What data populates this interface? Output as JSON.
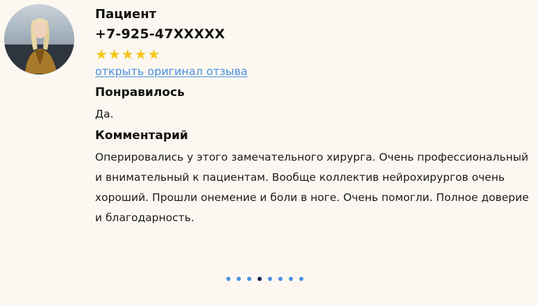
{
  "review": {
    "author": "Пациент",
    "phone": "+7-925-47XXXXX",
    "rating": 5,
    "rating_max": 5,
    "stars": "★★★★★",
    "link_label": "открыть оригинал отзыва",
    "liked_label": "Понравилось",
    "liked_value": "Да.",
    "comment_label": "Комментарий",
    "comment_text": "Оперировались у этого замечательного хирурга. Очень профессиональный и внимательный к пациентам. Вообще коллектив нейрохирургов очень хороший. Прошли онемение и боли в ноге. Очень помогли. Полное доверие и благодарность."
  },
  "pagination": {
    "total": 8,
    "active_index": 3
  },
  "colors": {
    "background": "#fcf8f1",
    "star": "#f5c518",
    "link": "#4a8fe2",
    "dot": "#4a90e2",
    "dot_active": "#0d1b4f"
  }
}
